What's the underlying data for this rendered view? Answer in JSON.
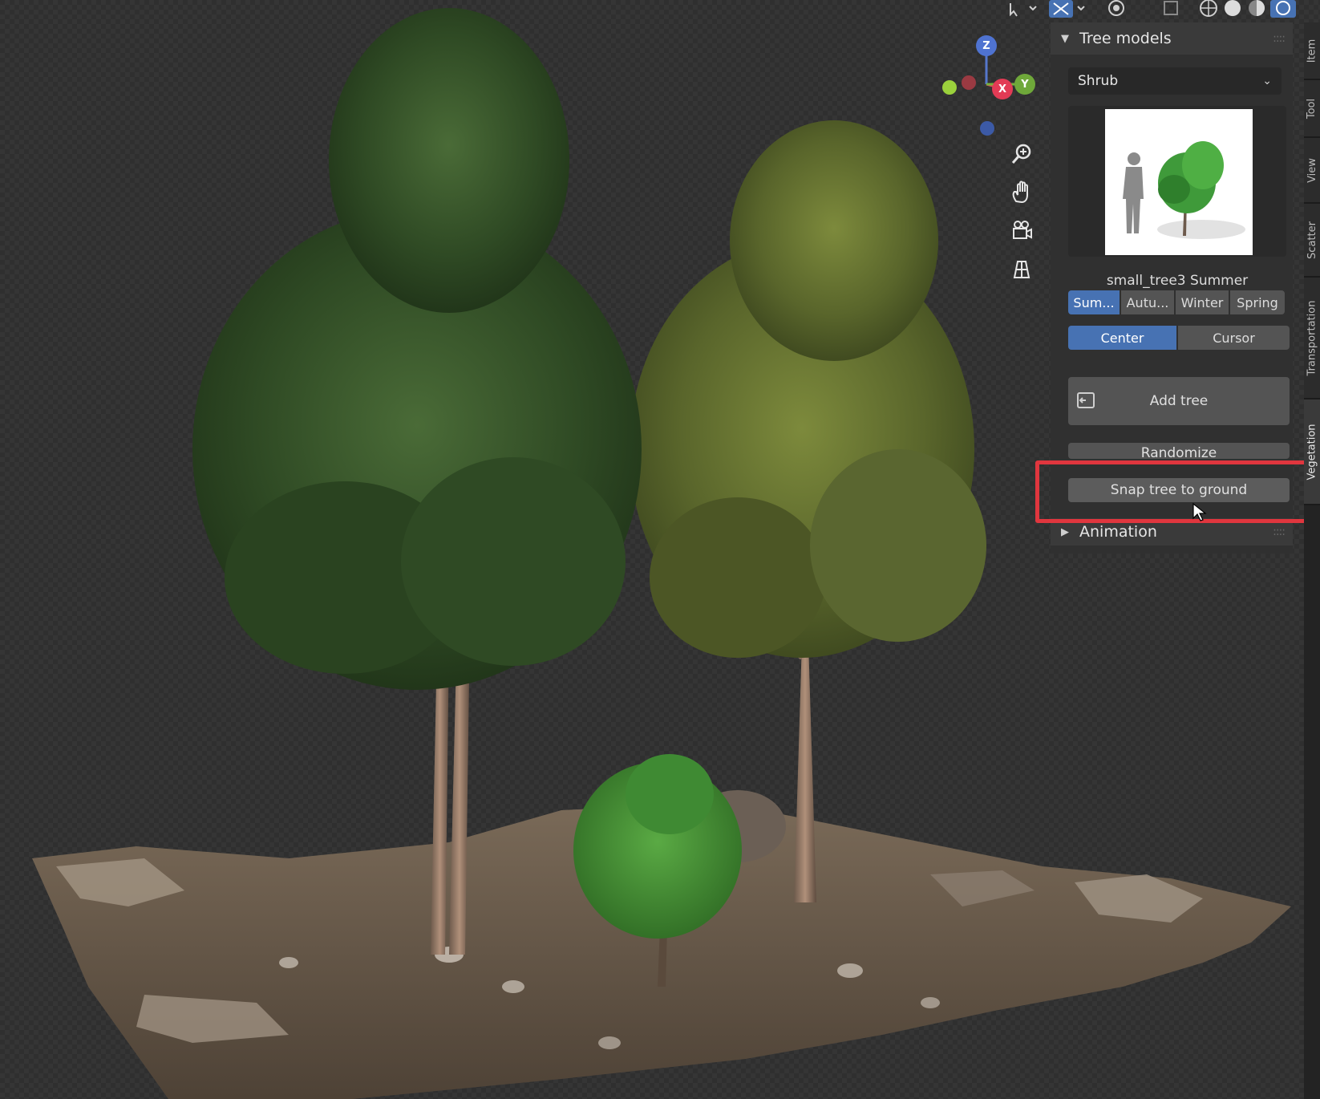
{
  "viewport": {
    "header_icons": [
      "select-tool-icon",
      "transform-gizmo-icon",
      "overlay-icon",
      "xray-icon",
      "wireframe-shading-icon",
      "solid-shading-icon",
      "material-shading-icon",
      "rendered-shading-icon"
    ],
    "gizmo": {
      "z_label": "Z",
      "x_label": "X",
      "y_label": "Y"
    },
    "nav_icons": [
      "zoom-icon",
      "pan-hand-icon",
      "camera-icon",
      "perspective-grid-icon"
    ]
  },
  "panel": {
    "tree_models_title": "Tree models",
    "category": "Shrub",
    "model_name": "small_tree3 Summer",
    "seasons": [
      "Sum...",
      "Autu...",
      "Winter",
      "Spring"
    ],
    "active_season_index": 0,
    "placement": [
      "Center",
      "Cursor"
    ],
    "active_placement_index": 0,
    "add_tree_label": "Add tree",
    "randomize_label": "Randomize",
    "snap_label": "Snap tree to ground",
    "animation_title": "Animation"
  },
  "vertical_tabs": [
    "Item",
    "Tool",
    "View",
    "Scatter",
    "Transportation",
    "Vegetation"
  ],
  "active_tab": "Vegetation"
}
